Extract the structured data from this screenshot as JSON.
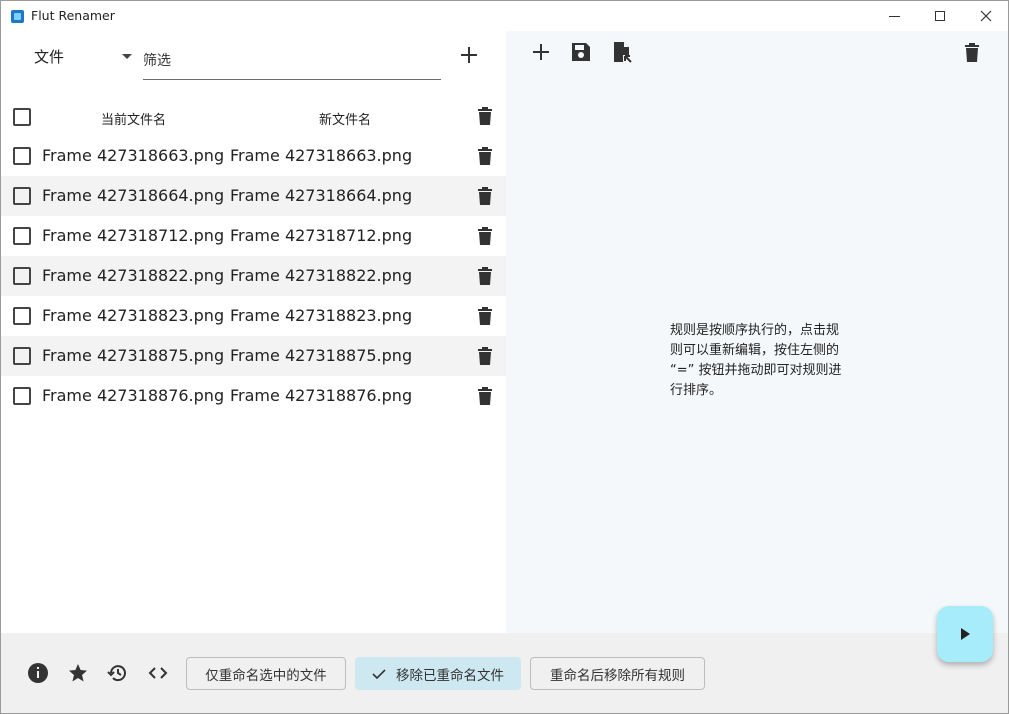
{
  "window": {
    "title": "Flut Renamer"
  },
  "left": {
    "file_menu_label": "文件",
    "filter_placeholder": "筛选",
    "columns": {
      "current": "当前文件名",
      "new": "新文件名"
    },
    "rows": [
      {
        "current": "Frame 427318663.png",
        "new": "Frame 427318663.png"
      },
      {
        "current": "Frame 427318664.png",
        "new": "Frame 427318664.png"
      },
      {
        "current": "Frame 427318712.png",
        "new": "Frame 427318712.png"
      },
      {
        "current": "Frame 427318822.png",
        "new": "Frame 427318822.png"
      },
      {
        "current": "Frame 427318823.png",
        "new": "Frame 427318823.png"
      },
      {
        "current": "Frame 427318875.png",
        "new": "Frame 427318875.png"
      },
      {
        "current": "Frame 427318876.png",
        "new": "Frame 427318876.png"
      }
    ]
  },
  "right": {
    "rules_hint": "规则是按顺序执行的，点击规则可以重新编辑，按住左侧的 “=” 按钮并拖动即可对规则进行排序。"
  },
  "bottom": {
    "only_selected_label": "仅重命名选中的文件",
    "remove_renamed_label": "移除已重命名文件",
    "remove_rules_label": "重命名后移除所有规则"
  },
  "icons": [
    "info-icon",
    "star-icon",
    "history-icon",
    "code-icon",
    "add-icon",
    "save-icon",
    "file-import-icon",
    "delete-icon",
    "play-icon",
    "check-icon"
  ],
  "colors": {
    "run_button": "#a7ecfa",
    "selected_chip": "#cde8f0",
    "right_panel_bg": "#f5f8fa",
    "bottom_bar_bg": "#f0f0f0",
    "alt_row_bg": "#f3f3f3"
  }
}
